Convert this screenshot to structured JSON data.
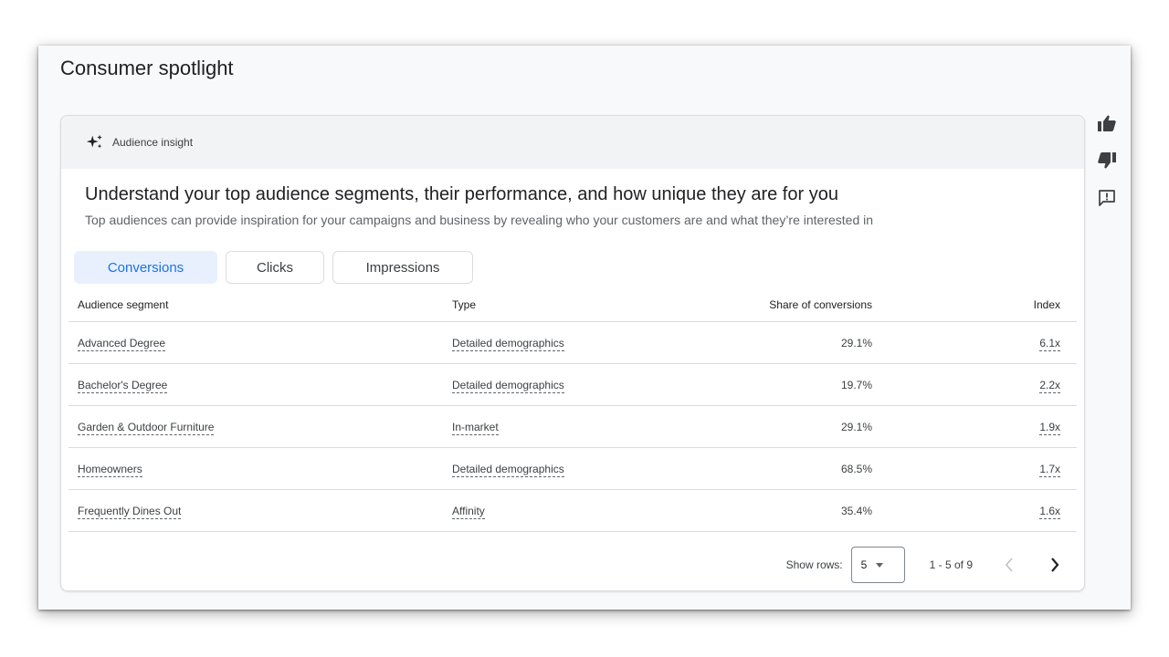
{
  "page": {
    "title": "Consumer spotlight"
  },
  "card": {
    "header_label": "Audience insight",
    "headline": "Understand your top audience segments, their performance, and how unique they are for you",
    "subheadline": "Top audiences can provide inspiration for your campaigns and business by revealing who your customers are and what they’re interested in"
  },
  "tabs": [
    {
      "label": "Conversions",
      "active": true
    },
    {
      "label": "Clicks",
      "active": false
    },
    {
      "label": "Impressions",
      "active": false
    }
  ],
  "table": {
    "columns": [
      "Audience segment",
      "Type",
      "Share of conversions",
      "Index"
    ],
    "rows": [
      {
        "segment": "Advanced Degree",
        "type": "Detailed demographics",
        "share": "29.1%",
        "index": "6.1x"
      },
      {
        "segment": "Bachelor's Degree",
        "type": "Detailed demographics",
        "share": "19.7%",
        "index": "2.2x"
      },
      {
        "segment": "Garden & Outdoor Furniture",
        "type": "In-market",
        "share": "29.1%",
        "index": "1.9x"
      },
      {
        "segment": "Homeowners",
        "type": "Detailed demographics",
        "share": "68.5%",
        "index": "1.7x"
      },
      {
        "segment": "Frequently Dines Out",
        "type": "Affinity",
        "share": "35.4%",
        "index": "1.6x"
      }
    ]
  },
  "pagination": {
    "show_rows_label": "Show rows:",
    "rows_per_page": "5",
    "range_text": "1 - 5 of 9"
  },
  "side_actions": {
    "icons": [
      "thumb-up-icon",
      "thumb-down-icon",
      "feedback-icon"
    ]
  },
  "colors": {
    "accent": "#1a73e8",
    "active_tab_bg": "#e8f0fe",
    "header_bg": "#f1f3f4",
    "border": "#dadce0"
  }
}
